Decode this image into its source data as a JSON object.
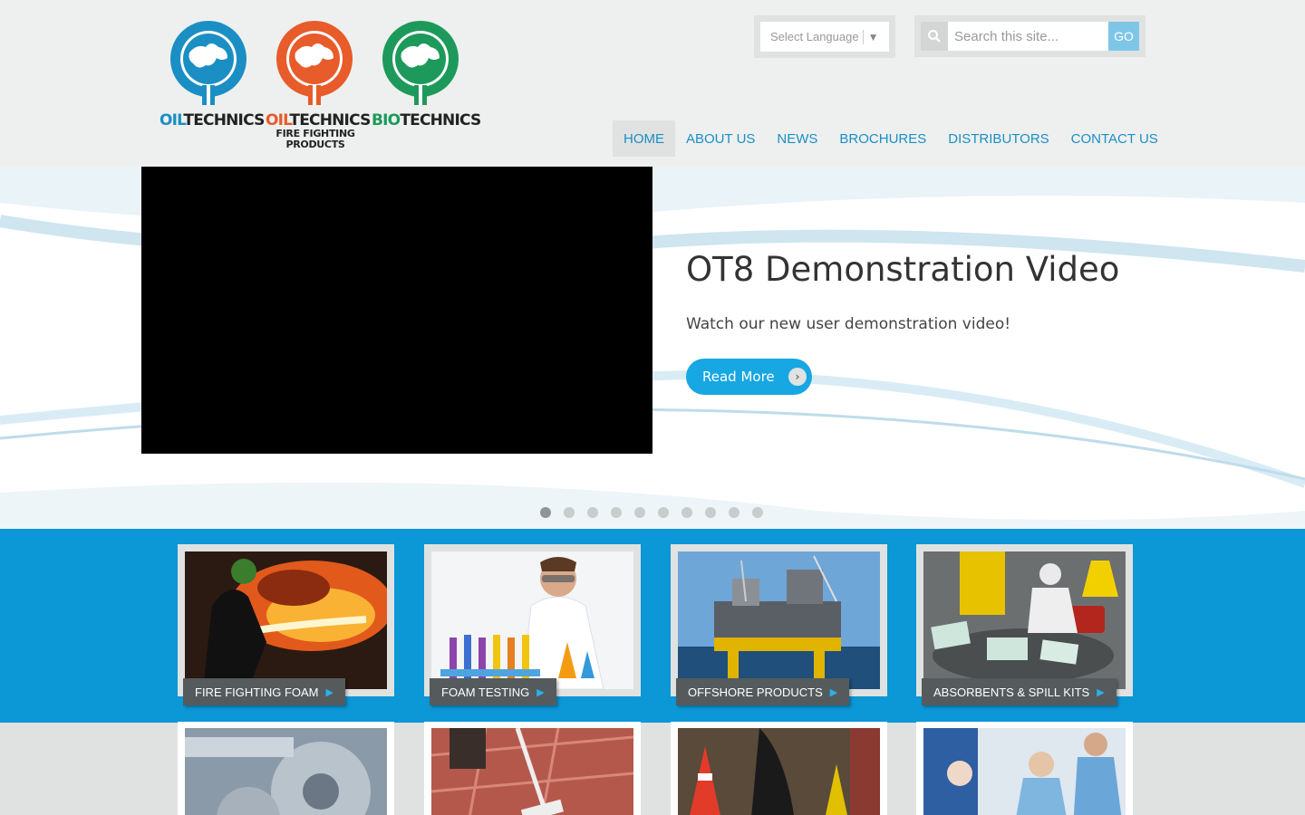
{
  "logos": [
    {
      "name": "oiltechnics",
      "text_a": "OIL",
      "text_b": "TECHNICS",
      "color": "#1b8fc4",
      "sub": ""
    },
    {
      "name": "oiltechnics-fire",
      "text_a": "OIL",
      "text_b": "TECHNICS",
      "color": "#e85b2a",
      "sub": "FIRE FIGHTING\nPRODUCTS"
    },
    {
      "name": "biotechnics",
      "text_a": "BIO",
      "text_b": "TECHNICS",
      "color": "#1d9a5b",
      "sub": ""
    }
  ],
  "language": {
    "label": "Select Language",
    "arrow": "▼"
  },
  "search": {
    "placeholder": "Search this site...",
    "go": "GO"
  },
  "nav": {
    "items": [
      "HOME",
      "ABOUT US",
      "NEWS",
      "BROCHURES",
      "DISTRIBUTORS",
      "CONTACT US"
    ],
    "active": "HOME"
  },
  "hero": {
    "title": "OT8 Demonstration Video",
    "text": "Watch our new user demonstration video!",
    "button": "Read More",
    "slides_count": 10,
    "active_slide": 1
  },
  "products_row1": [
    {
      "label": "FIRE FIGHTING FOAM"
    },
    {
      "label": "FOAM TESTING"
    },
    {
      "label": "OFFSHORE PRODUCTS"
    },
    {
      "label": "ABSORBENTS & SPILL KITS"
    }
  ],
  "colors": {
    "accent": "#0c97d6",
    "nav_text": "#1b8fc4",
    "button": "#17a7e3",
    "label_bg": "#555b5c"
  }
}
